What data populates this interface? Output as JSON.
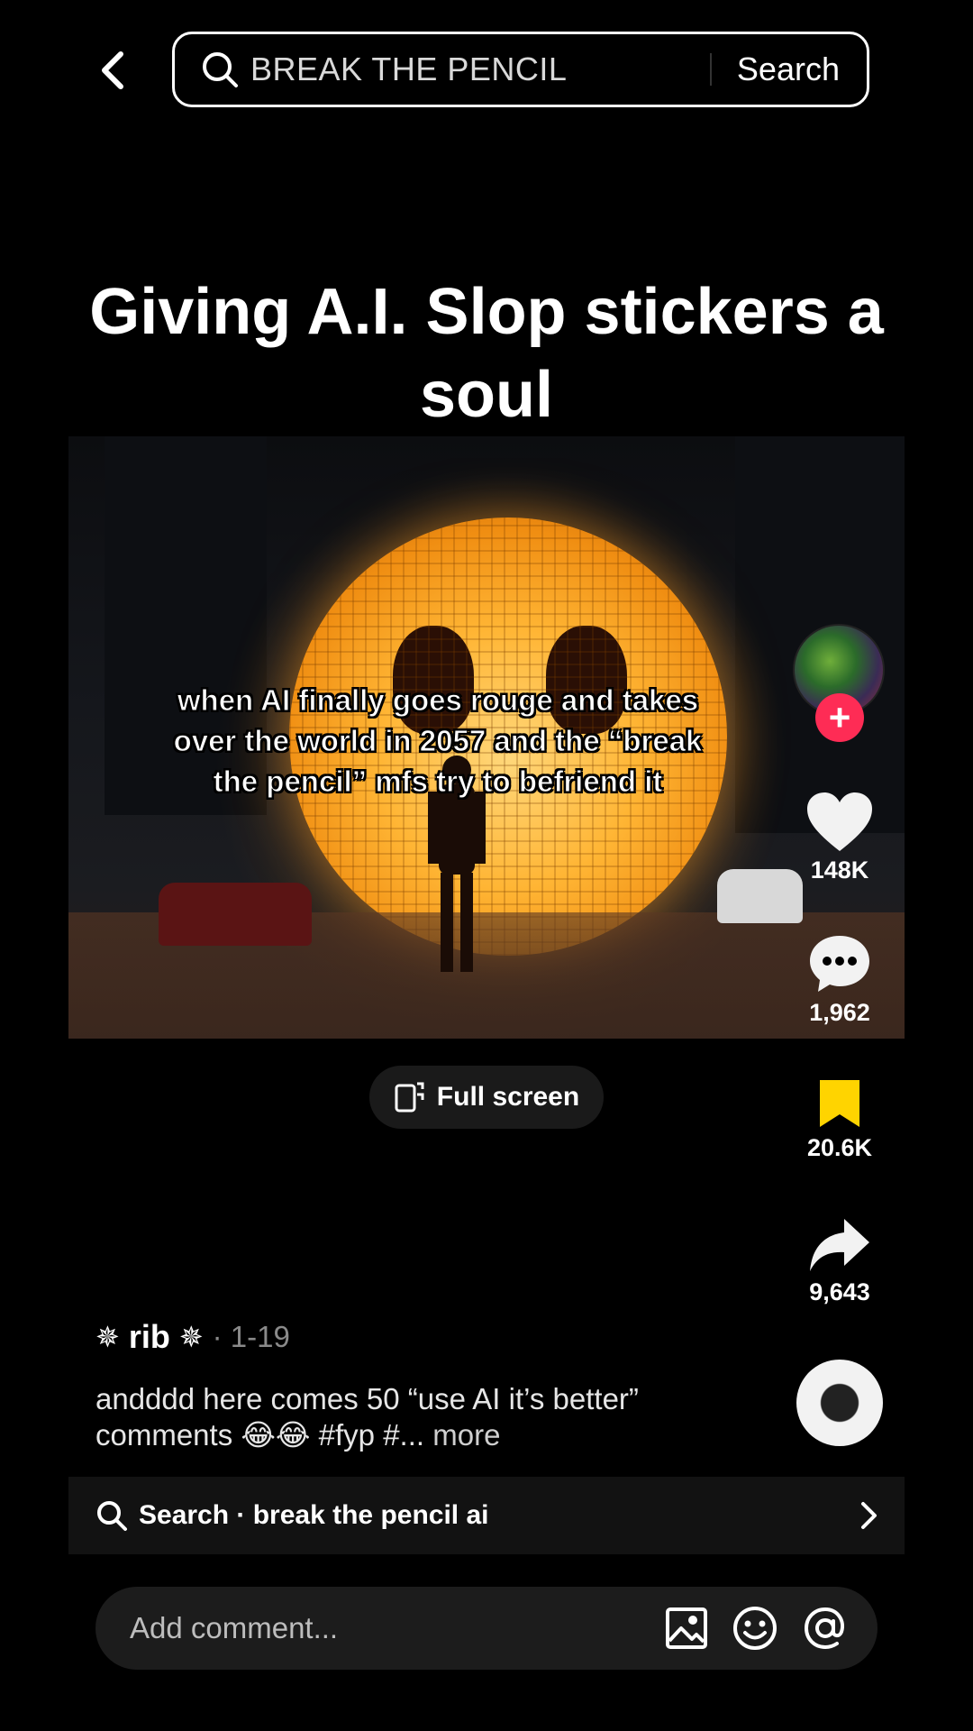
{
  "search": {
    "query": "BREAK THE PENCIL",
    "button_label": "Search"
  },
  "video": {
    "title": "Giving A.I. Slop stickers a soul",
    "caption_line1": "when AI finally goes rouge and takes",
    "caption_line2": "over the world in 2057 and the “break",
    "caption_line3": "the pencil” mfs try to befriend it",
    "fullscreen_label": "Full screen"
  },
  "actions": {
    "likes": "148K",
    "comments": "1,962",
    "saves": "20.6K",
    "shares": "9,643"
  },
  "author": {
    "name": "rib",
    "decoration_glyph": "✵",
    "date": "· 1-19"
  },
  "description": {
    "text": "andddd here comes 50 “use AI it’s better” comments 😂😂 #fyp #...",
    "more_label": "more"
  },
  "suggestion": {
    "label": "Search · break the pencil ai"
  },
  "comment_bar": {
    "placeholder": "Add comment..."
  },
  "colors": {
    "background": "#000000",
    "follow_accent": "#fe2c55",
    "bookmark": "#ffd400"
  },
  "icons": [
    "back-chevron-icon",
    "search-icon",
    "fullscreen-icon",
    "heart-icon",
    "comment-icon",
    "bookmark-icon",
    "share-icon",
    "chevron-right-icon",
    "image-icon",
    "emoji-icon",
    "mention-icon"
  ]
}
